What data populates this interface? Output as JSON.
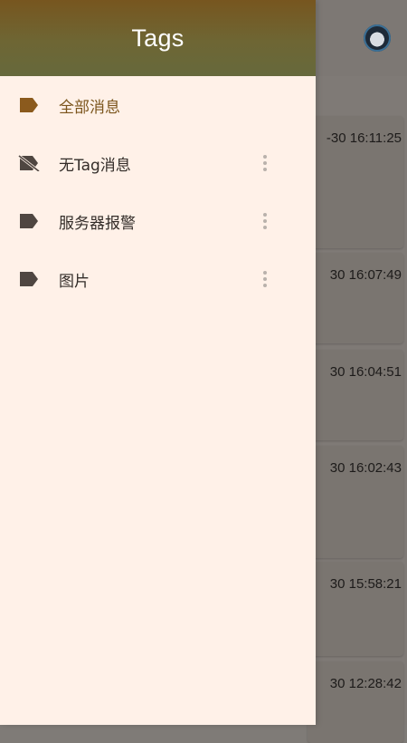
{
  "drawer": {
    "title": "Tags",
    "items": [
      {
        "label": "全部消息",
        "icon": "tag-icon",
        "active": true
      },
      {
        "label": "无Tag消息",
        "icon": "tag-off-icon",
        "active": false
      },
      {
        "label": "服务器报警",
        "icon": "tag-icon",
        "active": false
      },
      {
        "label": "图片",
        "icon": "tag-icon",
        "active": false
      }
    ]
  },
  "background": {
    "messages": [
      {
        "time": "-30 16:11:25"
      },
      {
        "time": "30 16:07:49"
      },
      {
        "time": "30 16:04:51"
      },
      {
        "time": "30 16:02:43"
      },
      {
        "time": "30 15:58:21"
      },
      {
        "time": "30 12:28:42"
      }
    ]
  },
  "colors": {
    "accent": "#7b551c",
    "drawer_bg": "#fff1e8",
    "header_gradient_top": "#77561f",
    "header_gradient_bottom": "#66693c",
    "scrim": "#7f7a76"
  }
}
